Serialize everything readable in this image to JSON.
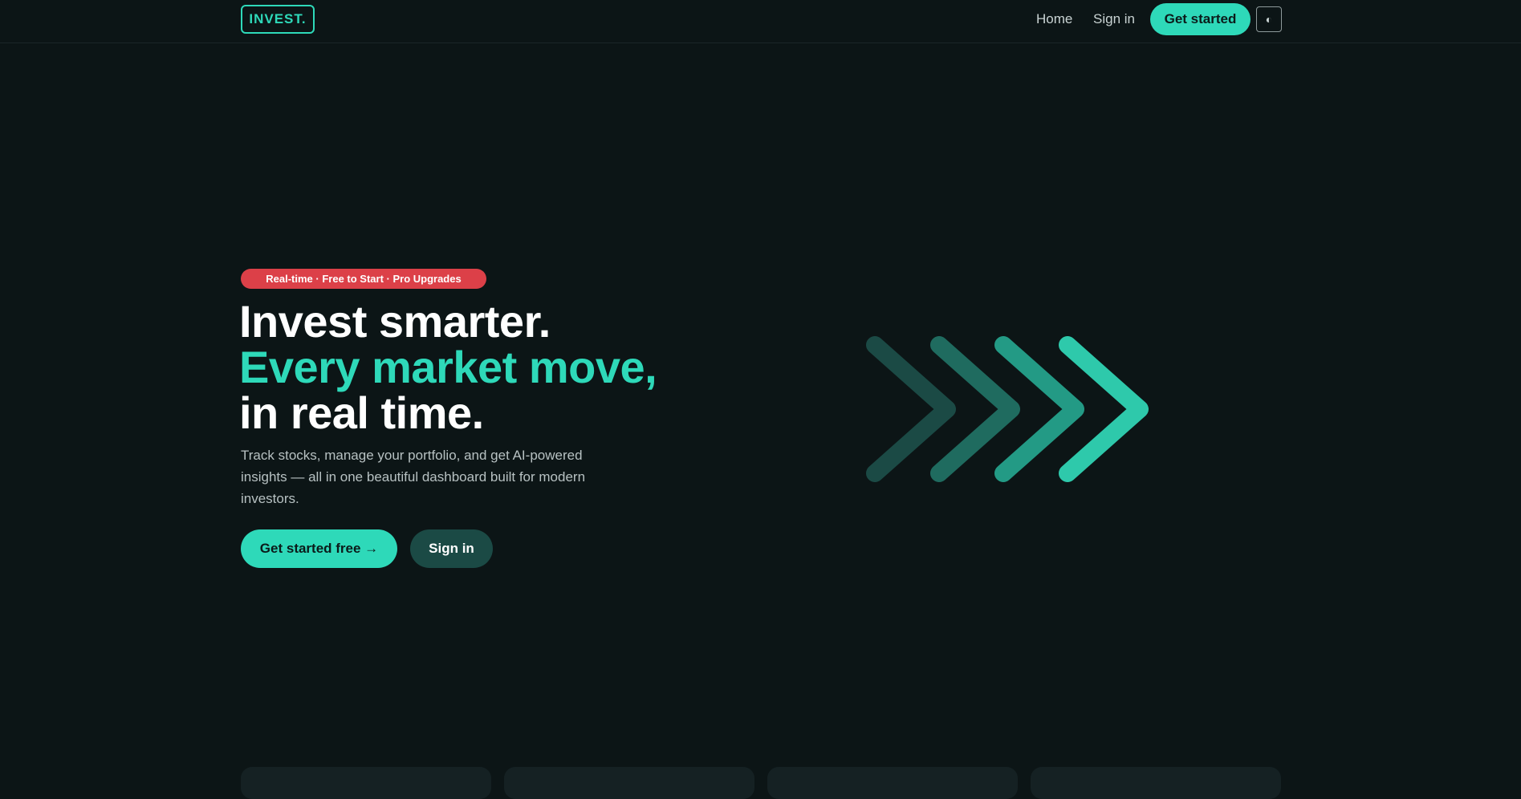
{
  "header": {
    "logo": "INVEST.",
    "nav": {
      "home": "Home",
      "sign_in": "Sign in"
    },
    "get_started": "Get started",
    "theme_toggle_glyph": "◐"
  },
  "hero": {
    "badge": "Real-time · Free to Start · Pro Upgrades",
    "headline": {
      "line1": "Invest smarter.",
      "line2": "Every market move,",
      "line3": "in real time."
    },
    "lead": "Track stocks, manage your portfolio, and get AI-powered insights — all in one beautiful dashboard built for modern investors.",
    "cta_primary": "Get started free →",
    "cta_secondary": "Sign in"
  },
  "colors": {
    "background": "#0c1516",
    "accent": "#2ed9b9",
    "badge": "#dc4048",
    "secondary_button": "#1b4a45"
  },
  "icons": {
    "hero_graphic": "chevrons-right-icon"
  }
}
